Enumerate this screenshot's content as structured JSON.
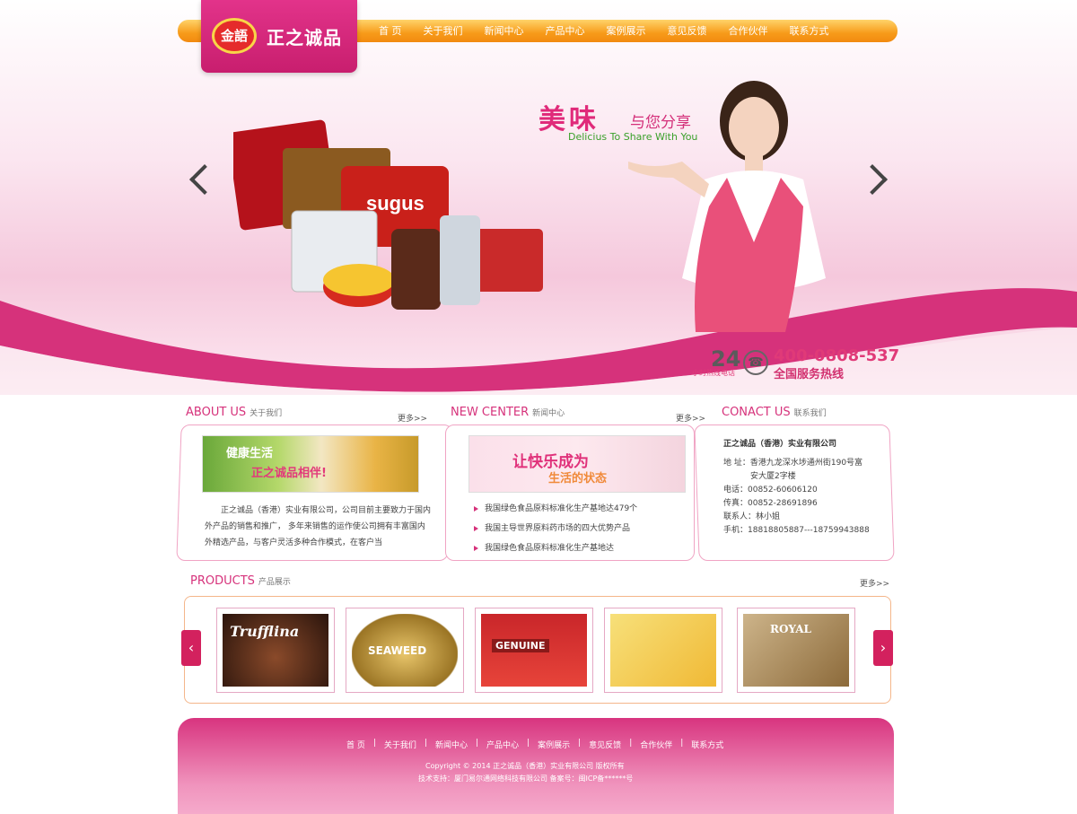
{
  "logo": {
    "seal": "金語",
    "name": "正之诚品"
  },
  "nav": [
    "首 页",
    "关于我们",
    "新闻中心",
    "产品中心",
    "案例展示",
    "意见反馈",
    "合作伙伴",
    "联系方式"
  ],
  "hero": {
    "title": "美味",
    "title2": "与您分享",
    "subtitle": "Delicius To Share With You",
    "hotline_hours": "24",
    "hotline_label": "小时热线电话",
    "phone": "400-0808-537",
    "hotline_text": "全国服务热线"
  },
  "about": {
    "title": "ABOUT US",
    "title_cn": "关于我们",
    "more": "更多>>",
    "banner_line1": "健康生活",
    "banner_line2": "正之诚品相伴!",
    "text": "正之诚品（香港）实业有限公司，公司目前主要致力于国内外产品的销售和推广， 多年来销售的运作使公司拥有丰富国内外精选产品，与客户灵活多种合作模式，在客户当"
  },
  "news": {
    "title": "NEW CENTER",
    "title_cn": "新闻中心",
    "more": "更多>>",
    "banner_line1": "让快乐成为",
    "banner_line2": "生活的状态",
    "items": [
      "我国绿色食品原料标准化生产基地达479个",
      "我国主导世界原料药市场的四大优势产品",
      "我国绿色食品原料标准化生产基地达"
    ]
  },
  "contact": {
    "title": "CONACT US",
    "title_cn": "联系我们",
    "company": "正之诚品（香港）实业有限公司",
    "address": "地  址：香港九龙深水埗通州街190号富",
    "address2": "安大厦2字楼",
    "tel": "电话：00852-60606120",
    "fax": "传真：00852-28691896",
    "person": "联系人：林小姐",
    "mobile": "手机：18818805887---18759943888"
  },
  "products": {
    "title": "PRODUCTS",
    "title_cn": "产品展示",
    "more": "更多>>",
    "items": [
      {
        "label": "Trufflina",
        "color": "#3b1f14"
      },
      {
        "label": "SEAWEED",
        "color": "#b98a2a"
      },
      {
        "label": "GENUINE",
        "color": "#c9262a"
      },
      {
        "label": "",
        "color": "#f3c83a"
      },
      {
        "label": "ROYAL",
        "color": "#8c6a3a"
      }
    ]
  },
  "footer": {
    "nav": [
      "首 页",
      "关于我们",
      "新闻中心",
      "产品中心",
      "案例展示",
      "意见反馈",
      "合作伙伴",
      "联系方式"
    ],
    "copyright": "Copyright © 2014 正之诚品（香港）实业有限公司  版权所有",
    "tech": "技术支持：厦门易尔通网络科技有限公司 备案号：闽ICP备******号"
  }
}
